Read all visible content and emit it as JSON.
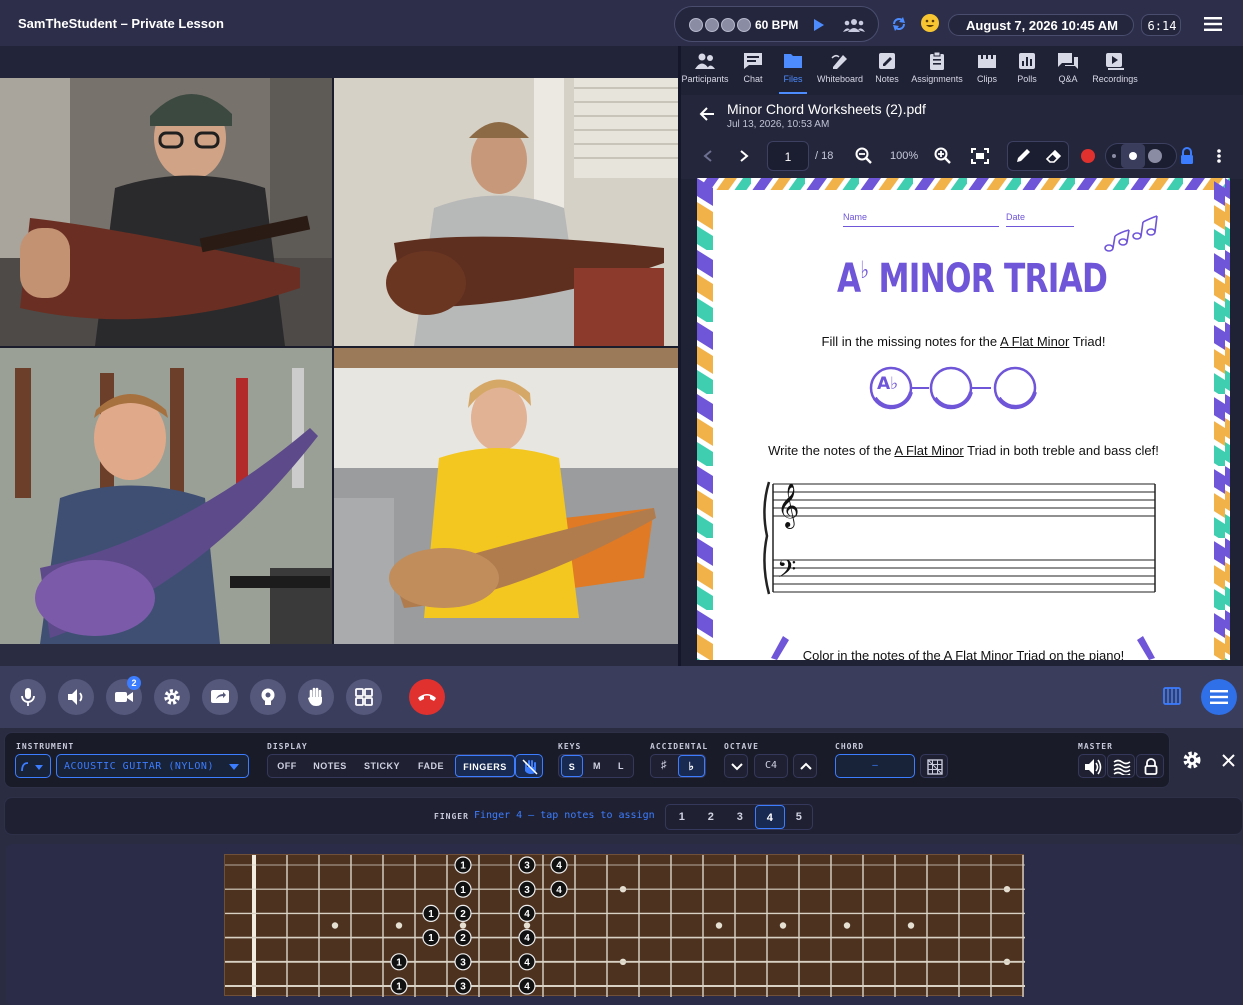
{
  "header": {
    "title": "SamTheStudent – Private Lesson",
    "bpm": "60 BPM",
    "date": "August 7, 2026 10:45 AM",
    "time": "6:14"
  },
  "tabs": [
    {
      "label": "Participants",
      "icon": "participants-icon"
    },
    {
      "label": "Chat",
      "icon": "chat-icon"
    },
    {
      "label": "Files",
      "icon": "folder-icon",
      "active": true
    },
    {
      "label": "Whiteboard",
      "icon": "whiteboard-icon"
    },
    {
      "label": "Notes",
      "icon": "notes-icon"
    },
    {
      "label": "Assignments",
      "icon": "assignments-icon"
    },
    {
      "label": "Clips",
      "icon": "clips-icon"
    },
    {
      "label": "Polls",
      "icon": "polls-icon"
    },
    {
      "label": "Q&A",
      "icon": "qa-icon"
    },
    {
      "label": "Recordings",
      "icon": "recordings-icon"
    }
  ],
  "file": {
    "name": "Minor Chord Worksheets (2).pdf",
    "date": "Jul 13, 2026, 10:53 AM",
    "page": "1",
    "total": "/ 18",
    "zoom": "100%"
  },
  "worksheet": {
    "name_label": "Name",
    "date_label": "Date",
    "title_letter": "A",
    "title_flat": "♭",
    "title_rest": "MINOR TRIAD",
    "q1_pre": "Fill in the missing notes for the ",
    "q1_link": "A Flat Minor",
    "q1_post": " Triad!",
    "note1": "A♭",
    "q2_pre": "Write the notes of the ",
    "q2_link": "A Flat Minor",
    "q2_post": " Triad in both treble and bass clef!",
    "q3": "Color in the notes of the A Flat Minor Triad on the piano!"
  },
  "controls": {
    "video_badge": "2"
  },
  "instrument": {
    "label": "INSTRUMENT",
    "value": "ACOUSTIC GUITAR (NYLON)",
    "display_label": "DISPLAY",
    "display_options": [
      "OFF",
      "NOTES",
      "STICKY",
      "FADE",
      "FINGERS"
    ],
    "display_selected": "FINGERS",
    "keys_label": "KEYS",
    "keys_options": [
      "S",
      "M",
      "L"
    ],
    "keys_selected": "S",
    "accidental_label": "ACCIDENTAL",
    "accidental_options": [
      "♯",
      "♭"
    ],
    "accidental_selected": "♭",
    "octave_label": "OCTAVE",
    "octave_value": "C4",
    "chord_label": "CHORD",
    "chord_value": "–",
    "master_label": "MASTER"
  },
  "finger": {
    "label": "FINGER",
    "hint": "Finger 4 – tap notes to assign",
    "options": [
      "1",
      "2",
      "3",
      "4",
      "5"
    ],
    "selected": "4"
  },
  "fretboard": {
    "strings": 6,
    "frets": 24,
    "markers": [
      {
        "string": 1,
        "fret": 7,
        "finger": "1"
      },
      {
        "string": 1,
        "fret": 9,
        "finger": "3"
      },
      {
        "string": 1,
        "fret": 10,
        "finger": "4"
      },
      {
        "string": 2,
        "fret": 7,
        "finger": "1"
      },
      {
        "string": 2,
        "fret": 9,
        "finger": "3"
      },
      {
        "string": 2,
        "fret": 10,
        "finger": "4"
      },
      {
        "string": 3,
        "fret": 6,
        "finger": "1"
      },
      {
        "string": 3,
        "fret": 7,
        "finger": "2"
      },
      {
        "string": 3,
        "fret": 9,
        "finger": "4"
      },
      {
        "string": 4,
        "fret": 6,
        "finger": "1"
      },
      {
        "string": 4,
        "fret": 7,
        "finger": "2"
      },
      {
        "string": 4,
        "fret": 9,
        "finger": "4"
      },
      {
        "string": 5,
        "fret": 5,
        "finger": "1"
      },
      {
        "string": 5,
        "fret": 7,
        "finger": "3"
      },
      {
        "string": 5,
        "fret": 9,
        "finger": "4"
      },
      {
        "string": 6,
        "fret": 5,
        "finger": "1"
      },
      {
        "string": 6,
        "fret": 7,
        "finger": "3"
      },
      {
        "string": 6,
        "fret": 9,
        "finger": "4"
      }
    ],
    "inlays": [
      3,
      5,
      7,
      9,
      12,
      15,
      17,
      19,
      21,
      24
    ]
  },
  "colors": {
    "accent": "#3c7dff",
    "end_call": "#e0312f",
    "worksheet_purple": "#6f55d8"
  }
}
